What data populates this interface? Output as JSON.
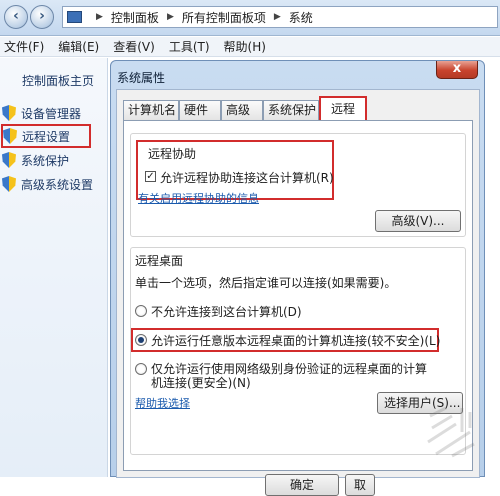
{
  "breadcrumb": [
    "控制面板",
    "所有控制面板项",
    "系统"
  ],
  "menu": [
    "文件(F)",
    "编辑(E)",
    "查看(V)",
    "工具(T)",
    "帮助(H)"
  ],
  "left_pane": {
    "home": "控制面板主页",
    "items": [
      {
        "label": "设备管理器",
        "icon": "shield-icon"
      },
      {
        "label": "远程设置",
        "icon": "shield-icon"
      },
      {
        "label": "系统保护",
        "icon": "shield-icon"
      },
      {
        "label": "高级系统设置",
        "icon": "shield-icon"
      }
    ]
  },
  "dialog": {
    "title": "系统属性",
    "close": "x",
    "tabs": [
      "计算机名",
      "硬件",
      "高级",
      "系统保护",
      "远程"
    ],
    "active_tab": "远程",
    "remote_assistance": {
      "title": "远程协助",
      "checkbox_label": "允许远程协助连接这台计算机(R)",
      "checked": true,
      "help_link": "有关启用远程协助的信息",
      "advanced_button": "高级(V)..."
    },
    "remote_desktop": {
      "title": "远程桌面",
      "instruction": "单击一个选项，然后指定谁可以连接(如果需要)。",
      "options": [
        {
          "label": "不允许连接到这台计算机(D)",
          "selected": false
        },
        {
          "label": "允许运行任意版本远程桌面的计算机连接(较不安全)(L)",
          "selected": true
        },
        {
          "label_line1": "仅允许运行使用网络级别身份验证的远程桌面的计算",
          "label_line2": "机连接(更安全)(N)",
          "selected": false
        }
      ],
      "help_link": "帮助我选择",
      "select_users_button": "选择用户(S)..."
    },
    "ok_button": "确定",
    "cancel_button": "取"
  },
  "colors": {
    "highlight": "#d22c2c",
    "link": "#1a5aad"
  }
}
